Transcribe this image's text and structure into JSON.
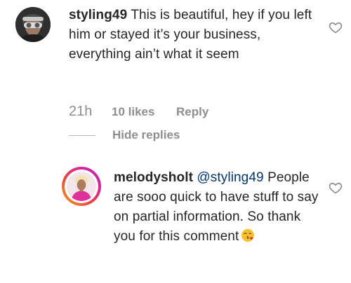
{
  "comment": {
    "username": "styling49",
    "text": "This is beautiful, hey if you left him or stayed it’s your business, everything ain’t what it seem",
    "time": "21h",
    "likes": "10 likes",
    "reply_label": "Reply",
    "like_icon": "heart-outline-icon"
  },
  "replies_toggle": {
    "label": "Hide replies"
  },
  "reply": {
    "username": "melodysholt",
    "mention": "@styling49",
    "text": "People are sooo quick to have stuff to say on partial information. So thank you for this comment",
    "emoji": "face-blowing-a-kiss-emoji",
    "like_icon": "heart-outline-icon",
    "story_ring_colors": [
      "#f9a52b",
      "#e8463f",
      "#d6249f",
      "#a430b5"
    ]
  }
}
